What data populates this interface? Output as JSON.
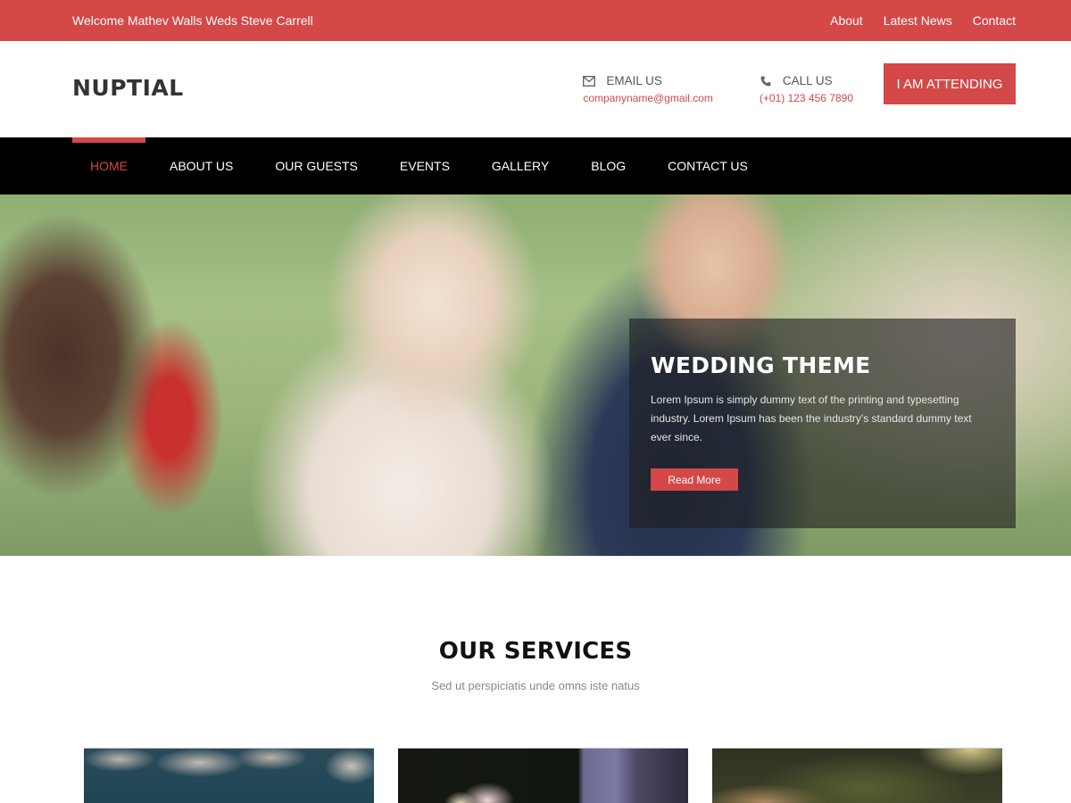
{
  "topbar": {
    "welcome": "Welcome Mathev Walls Weds Steve Carrell",
    "links": [
      "About",
      "Latest News",
      "Contact"
    ]
  },
  "header": {
    "logo": "NUPTIAL",
    "email": {
      "icon": "envelope-icon",
      "label": "EMAIL US",
      "value": "companyname@gmail.com"
    },
    "call": {
      "icon": "phone-icon",
      "label": "CALL US",
      "value": "(+01) 123 456 7890"
    },
    "cta_label": "I AM ATTENDING"
  },
  "nav": {
    "items": [
      "HOME",
      "ABOUT US",
      "OUR GUESTS",
      "EVENTS",
      "GALLERY",
      "BLOG",
      "CONTACT US"
    ],
    "active": "HOME"
  },
  "hero": {
    "title": "WEDDING THEME",
    "text": "Lorem Ipsum is simply dummy text of the printing and typesetting industry. Lorem Ipsum has been the industry's standard dummy text ever since.",
    "button_label": "Read More"
  },
  "services": {
    "title": "OUR SERVICES",
    "subtitle": "Sed ut perspiciatis unde omns iste natus"
  },
  "colors": {
    "accent": "#d44848",
    "nav_bg": "#000000",
    "text_dark": "#333333"
  }
}
